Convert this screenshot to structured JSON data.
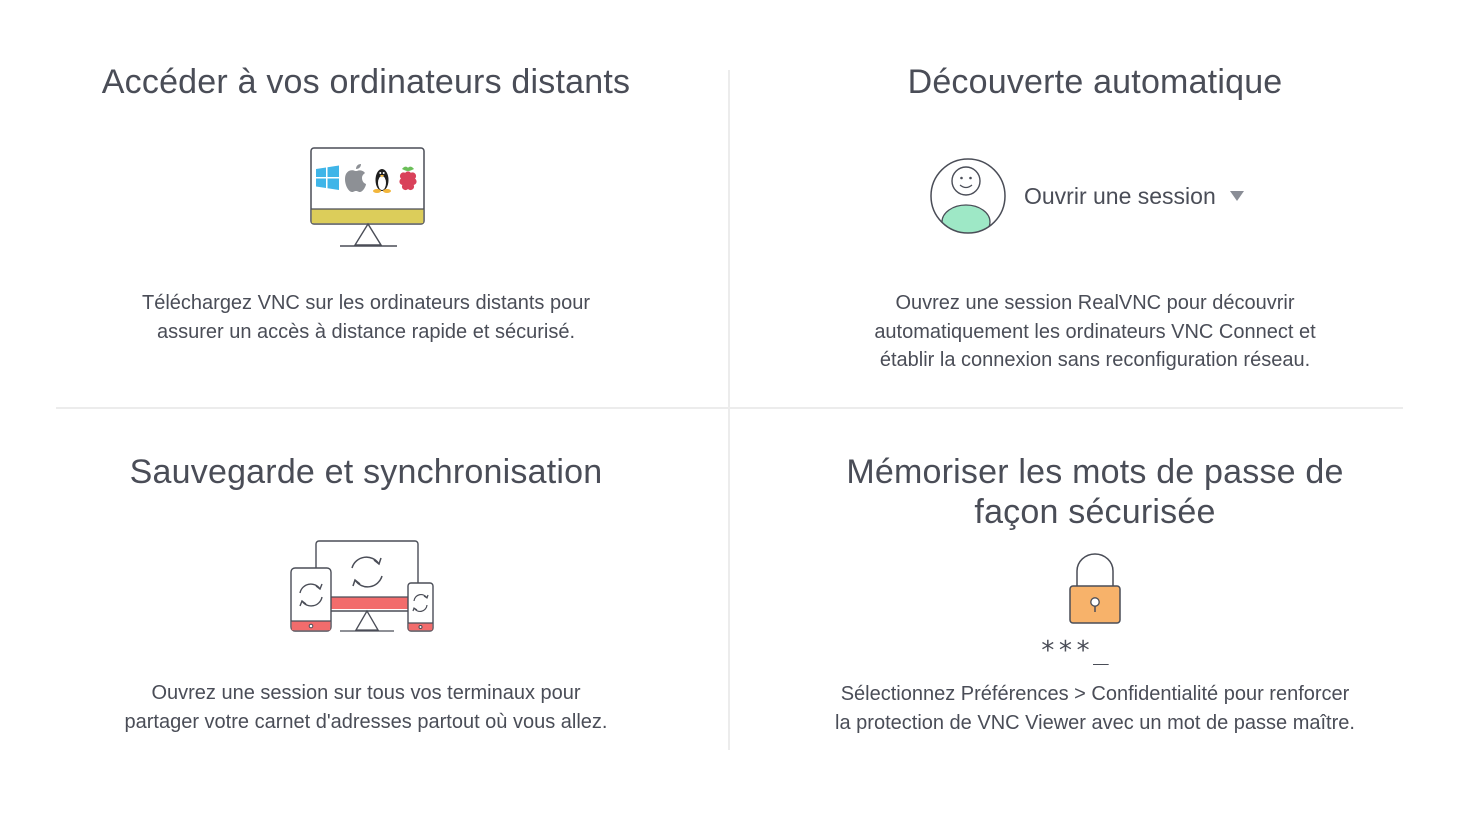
{
  "panels": {
    "remote": {
      "title": "Accéder à vos ordinateurs distants",
      "text_line1": "Téléchargez VNC sur les ordinateurs distants pour",
      "text_line2": "assurer un accès à distance rapide et sécurisé.",
      "icon": "monitor-os-icon"
    },
    "discovery": {
      "title": "Découverte automatique",
      "signin_label": "Ouvrir une session",
      "text_line1": "Ouvrez une session RealVNC pour découvrir",
      "text_line2": "automatiquement les ordinateurs VNC Connect et",
      "text_line3": "établir la connexion sans reconfiguration réseau.",
      "icon": "user-avatar-icon"
    },
    "sync": {
      "title": "Sauvegarde et synchronisation",
      "text_line1": "Ouvrez une session sur tous vos terminaux pour",
      "text_line2": "partager votre carnet d'adresses partout où vous allez.",
      "icon": "devices-sync-icon"
    },
    "passwords": {
      "title_line1": "Mémoriser les mots de passe de",
      "title_line2": "façon sécurisée",
      "password_mask": "***_",
      "text_line1": "Sélectionnez Préférences > Confidentialité pour renforcer",
      "text_line2": "la protection de VNC Viewer avec un mot de passe maître.",
      "icon": "padlock-icon"
    }
  },
  "colors": {
    "windows_blue": "#3fb5e8",
    "apple_gray": "#8d9095",
    "monitor_bar": "#dccd5a",
    "avatar_green": "#9ee8c6",
    "sync_red": "#f26c6c",
    "lock_orange": "#f7b26a",
    "raspberry": "#d9415a"
  }
}
